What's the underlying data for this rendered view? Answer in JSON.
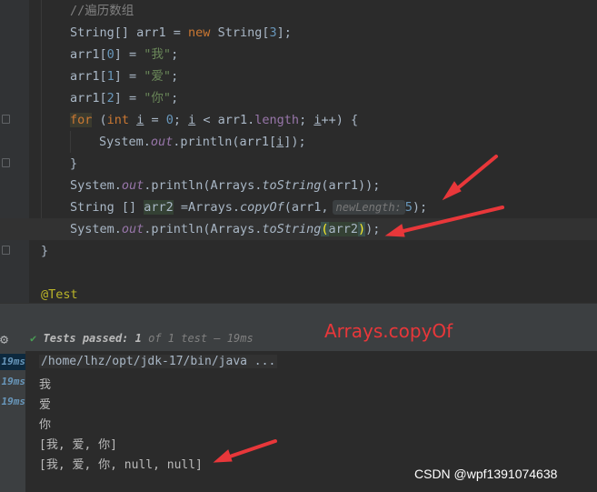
{
  "editor": {
    "comment": "//遍历数组",
    "l2": {
      "type": "String[] arr1 = ",
      "kw": "new",
      "rest": " String[",
      "num": "3",
      "end": "];"
    },
    "arr_lines": [
      {
        "pre": "arr1[",
        "idx": "0",
        "mid": "] = ",
        "val": "\"我\"",
        "end": ";"
      },
      {
        "pre": "arr1[",
        "idx": "1",
        "mid": "] = ",
        "val": "\"爱\"",
        "end": ";"
      },
      {
        "pre": "arr1[",
        "idx": "2",
        "mid": "] = ",
        "val": "\"你\"",
        "end": ";"
      }
    ],
    "for_line": {
      "kw": "for",
      "p1": " (",
      "int": "int",
      "p2": " ",
      "i1": "i",
      "p3": " = ",
      "zero": "0",
      "p4": "; ",
      "i2": "i",
      "p5": " < arr1.",
      "len": "length",
      "p6": "; ",
      "i3": "i",
      "p7": "++) {"
    },
    "print_line": {
      "pre": "System.",
      "out": "out",
      "mid": ".println(arr1[",
      "i": "i",
      "end": "]);"
    },
    "close_brace": "}",
    "print_to_string": {
      "pre": "System.",
      "out": "out",
      "mid": ".println(Arrays.",
      "m": "toString",
      "end": "(arr1));"
    },
    "copy_line": {
      "pre": "String [] ",
      "var": "arr2",
      "mid": " =Arrays.",
      "m": "copyOf",
      "args": "(arr1,",
      "hint": "newLength:",
      "num": "5",
      "end": ");"
    },
    "print_arr2": {
      "pre": "System.",
      "out": "out",
      "mid": ".println(Arrays.",
      "m": "toString",
      "paren": "(",
      "var": "arr2",
      "close": ")",
      "end": ");"
    },
    "method_close": "}",
    "annotation": "@Test"
  },
  "run_panel": {
    "status": {
      "label": "Tests passed:",
      "count": "1",
      "of": "of 1 test",
      "time": "– 19ms"
    },
    "tree_times": [
      "19ms",
      "19ms",
      "19ms"
    ],
    "console_lines": [
      "/home/lhz/opt/jdk-17/bin/java ...",
      "我",
      "爱",
      "你",
      "[我, 爱, 你]",
      "[我, 爱, 你, null, null]"
    ]
  },
  "overlay": {
    "annotation_text": "Arrays.copyOf",
    "watermark": "CSDN @wpf1391074638",
    "arrow_color": "#e8373a"
  }
}
